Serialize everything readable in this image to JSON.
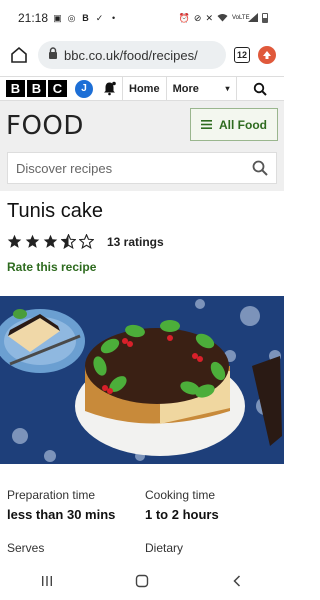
{
  "status_bar": {
    "time": "21:18",
    "network_label": "VoLTE"
  },
  "browser": {
    "url": "bbc.co.uk/food/recipes/",
    "tab_count": "12"
  },
  "bbc_header": {
    "logo_letters": [
      "B",
      "B",
      "C"
    ],
    "account_initial": "J",
    "nav": {
      "home": "Home",
      "more": "More"
    }
  },
  "food_section": {
    "title": "FOOD",
    "all_food_label": "All Food",
    "search_placeholder": "Discover recipes"
  },
  "recipe": {
    "title": "Tunis cake",
    "rating_value": 3.5,
    "rating_max": 5,
    "ratings_text": "13 ratings",
    "rate_link": "Rate this recipe",
    "prep_label": "Preparation time",
    "prep_value": "less than 30 mins",
    "cook_label": "Cooking time",
    "cook_value": "1 to 2 hours",
    "serves_label": "Serves",
    "dietary_label": "Dietary"
  },
  "colors": {
    "accent_green": "#2e6b1f",
    "account_blue": "#1d6fd6",
    "extension_orange": "#e0593b"
  }
}
